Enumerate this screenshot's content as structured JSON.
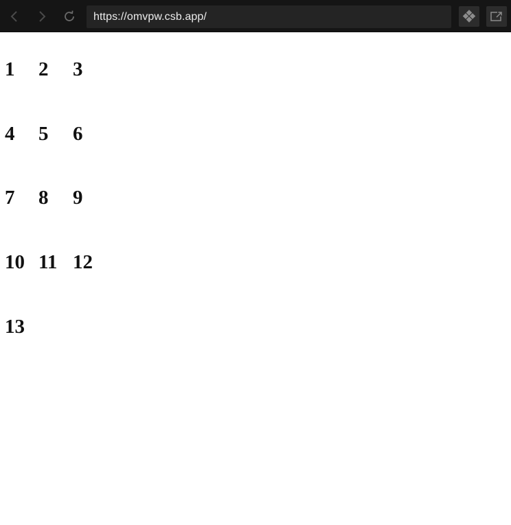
{
  "browser": {
    "url": "https://omvpw.csb.app/",
    "icons": {
      "back": "chevron-left-icon",
      "forward": "chevron-right-icon",
      "reload": "reload-icon",
      "codesandbox": "codesandbox-logo-icon",
      "open_new_window": "external-link-icon"
    }
  },
  "page": {
    "items": [
      "1",
      "2",
      "3",
      "4",
      "5",
      "6",
      "7",
      "8",
      "9",
      "10",
      "11",
      "12",
      "13"
    ]
  }
}
